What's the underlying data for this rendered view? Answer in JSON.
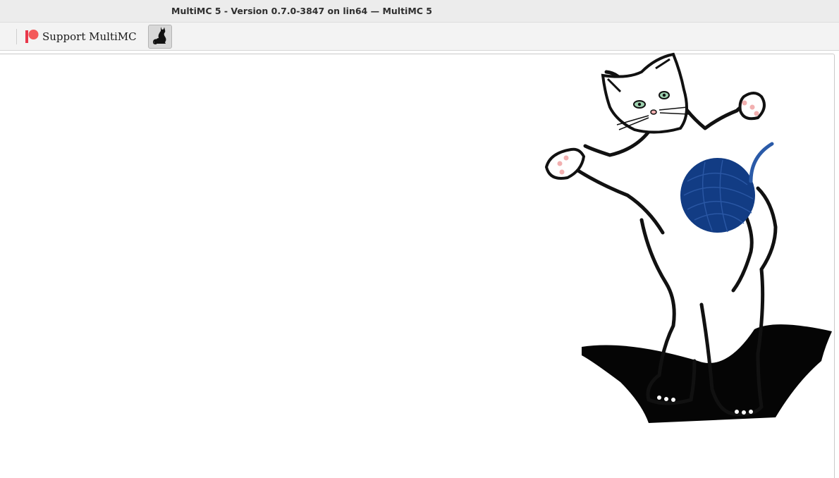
{
  "window": {
    "title": "MultiMC 5 - Version 0.7.0-3847 on lin64 — MultiMC 5"
  },
  "toolbar": {
    "support_label": "Support MultiMC",
    "support_icon": "patreon-icon",
    "cat_icon": "cat-icon"
  },
  "colors": {
    "patreon_red": "#f96854",
    "patreon_bar": "#e8374b",
    "yarn_blue": "#123c84"
  }
}
